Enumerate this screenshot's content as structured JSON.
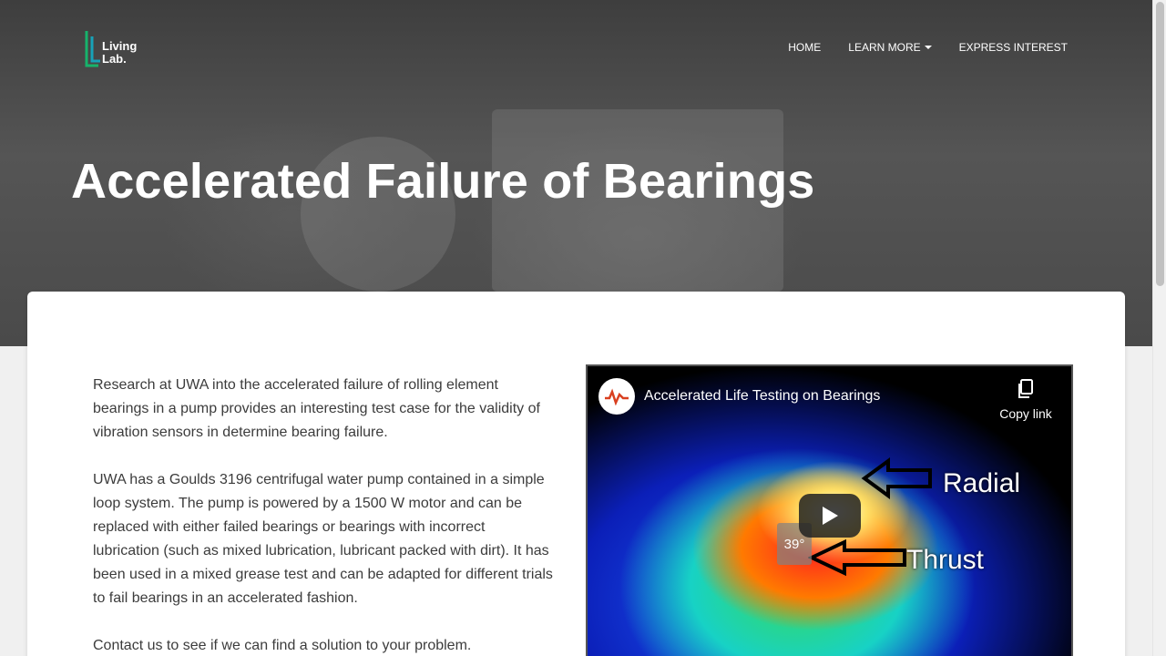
{
  "header": {
    "logo_line1": "Living",
    "logo_line2": "Lab.",
    "nav": [
      {
        "label": "HOME"
      },
      {
        "label": "LEARN MORE"
      },
      {
        "label": "EXPRESS INTEREST"
      }
    ]
  },
  "hero": {
    "title": "Accelerated Failure of Bearings"
  },
  "content": {
    "paragraphs": [
      "Research at UWA into the accelerated failure of rolling element bearings in a pump provides an interesting test case for the validity of vibration sensors in determine bearing failure.",
      "UWA has a Goulds 3196 centrifugal water pump contained in a simple loop system. The pump is powered by a 1500 W motor and can be replaced with either failed bearings or bearings with incorrect lubrication (such as mixed lubrication, lubricant packed with dirt). It has been used in a mixed grease test and can be adapted for different trials to fail bearings in an accelerated fashion.",
      "Contact us to see if we can find a solution to your problem."
    ]
  },
  "video": {
    "title": "Accelerated Life Testing on Bearings",
    "copy_link": "Copy link",
    "label_radial": "Radial",
    "label_thrust": "Thrust",
    "temp_readout": "39°"
  },
  "colors": {
    "logo_green": "#16b36b",
    "logo_teal": "#17a2b8",
    "hero_bg": "#4a4a4a"
  }
}
